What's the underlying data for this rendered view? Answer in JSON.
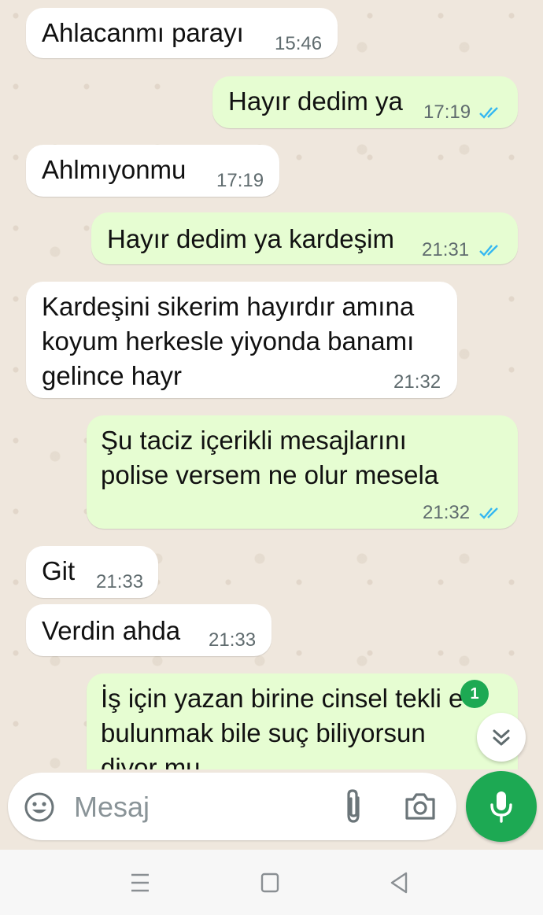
{
  "messages": [
    {
      "dir": "in",
      "text": "Ahlacanmı parayı",
      "time": "15:46"
    },
    {
      "dir": "out",
      "text": "Hayır dedim ya",
      "time": "17:19",
      "read": true
    },
    {
      "dir": "in",
      "text": "Ahlmıyonmu",
      "time": "17:19"
    },
    {
      "dir": "out",
      "text": "Hayır dedim ya kardeşim",
      "time": "21:31",
      "read": true
    },
    {
      "dir": "in",
      "text": "Kardeşini sikerim hayırdır amına\nkoyum herkesle yiyonda banamı\ngelince hayr",
      "time": "21:32"
    },
    {
      "dir": "out",
      "text": "Şu taciz içerikli mesajlarını\npolise versem ne olur mesela",
      "time": "21:32",
      "read": true
    },
    {
      "dir": "in",
      "text": "Git",
      "time": "21:33"
    },
    {
      "dir": "in",
      "text": "Verdin ahda",
      "time": "21:33"
    },
    {
      "dir": "out",
      "text": "İş için yazan birine cinsel tekli e\nbulunmak bile suç biliyorsun\ndiyor mu",
      "time": "",
      "read": true
    }
  ],
  "unread_badge": "1",
  "composer": {
    "placeholder": "Mesaj",
    "emoji_icon": "emoji-smile-icon",
    "attach_icon": "paperclip-icon",
    "camera_icon": "camera-icon",
    "mic_icon": "microphone-icon"
  },
  "navbar": {
    "menu_icon": "menu-lines-icon",
    "home_icon": "square-home-icon",
    "back_icon": "triangle-back-icon"
  },
  "colors": {
    "accent": "#1da953",
    "outgoing_bubble": "#e6fdd2",
    "incoming_bubble": "#ffffff",
    "read_ticks": "#34b7f1",
    "wallpaper": "#efe7dd"
  }
}
